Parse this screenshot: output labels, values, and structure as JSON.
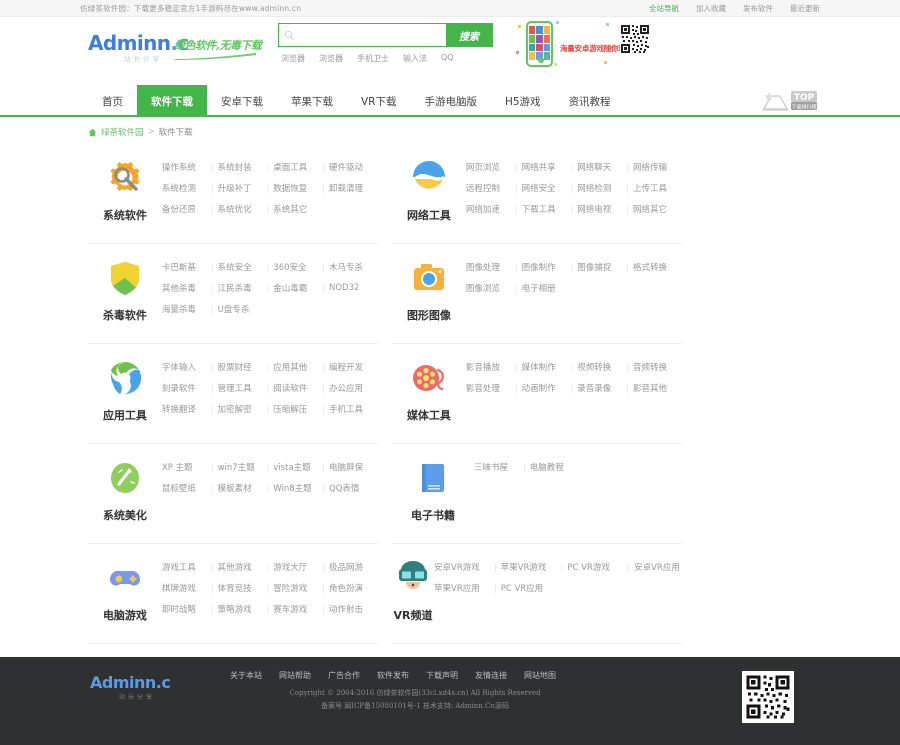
{
  "topbar": {
    "notice": "仿绿茶软件园：下载更多稳定官方1手游码尽在www.adminn.cn",
    "links": [
      {
        "label": "全站导航",
        "highlight": true
      },
      {
        "label": "加入收藏",
        "highlight": false
      },
      {
        "label": "发布软件",
        "highlight": false
      },
      {
        "label": "最近更新",
        "highlight": false
      }
    ]
  },
  "header": {
    "logo_text": "Adminn",
    "logo_suffix": ".c",
    "logo_sub": "站长分享",
    "logo_tagline": "绿色软件,无毒下载",
    "search": {
      "value": "",
      "placeholder": "",
      "button_label": "搜索",
      "icon": "search-icon"
    },
    "hot_words": [
      "浏览器",
      "浏览器",
      "手机卫士",
      "输入法",
      "QQ"
    ],
    "promo": {
      "text": "海量安卓游戏随你玩",
      "qr_label": "qr-code-icon"
    }
  },
  "nav": {
    "items": [
      {
        "label": "首页",
        "active": false
      },
      {
        "label": "软件下载",
        "active": true
      },
      {
        "label": "安卓下载",
        "active": false
      },
      {
        "label": "苹果下载",
        "active": false
      },
      {
        "label": "VR下载",
        "active": false
      },
      {
        "label": "手游电脑版",
        "active": false
      },
      {
        "label": "H5游戏",
        "active": false
      },
      {
        "label": "资讯教程",
        "active": false
      }
    ],
    "badge": {
      "label": "TOP",
      "sub": "下载排行榜"
    }
  },
  "breadcrumb": {
    "home_icon": "home-icon",
    "root": "绿茶软件园",
    "separator": ">",
    "current": "软件下载"
  },
  "categories": [
    {
      "name": "系统软件",
      "icon": "gear-wrench-icon",
      "color": "#f5a623",
      "rows": [
        [
          "操作系统",
          "系统封装",
          "桌面工具",
          "硬件驱动"
        ],
        [
          "系统检测",
          "升级补丁",
          "数据恢复",
          "卸载清理"
        ],
        [
          "备份还原",
          "系统优化",
          "系统其它"
        ]
      ]
    },
    {
      "name": "网络工具",
      "icon": "globe-icon",
      "color": "#4aa3e8",
      "rows": [
        [
          "网页浏览",
          "网络共享",
          "网络聊天",
          "网络传输"
        ],
        [
          "远程控制",
          "网络安全",
          "网络检测",
          "上传工具"
        ],
        [
          "网络加速",
          "下载工具",
          "网络电视",
          "网络其它"
        ]
      ]
    },
    {
      "name": "杀毒软件",
      "icon": "shield-icon",
      "color": "#6cc24a",
      "rows": [
        [
          "卡巴斯基",
          "系统安全",
          "360安全",
          "木马专杀"
        ],
        [
          "其他杀毒",
          "江民杀毒",
          "金山毒霸",
          "NOD32"
        ],
        [
          "海量杀毒",
          "U盘专杀"
        ]
      ]
    },
    {
      "name": "图形图像",
      "icon": "camera-icon",
      "color": "#f7b13a",
      "rows": [
        [
          "图像处理",
          "图像制作",
          "图像捕捉",
          "格式转换"
        ],
        [
          "图像浏览",
          "电子相册"
        ]
      ]
    },
    {
      "name": "应用工具",
      "icon": "recycle-icon",
      "color": "#4aa3e8",
      "rows": [
        [
          "字体输入",
          "股票财经",
          "应用其他",
          "编程开发"
        ],
        [
          "刻录软件",
          "管理工具",
          "阅读软件",
          "办公应用"
        ],
        [
          "转换翻译",
          "加密解密",
          "压缩解压",
          "手机工具"
        ]
      ]
    },
    {
      "name": "媒体工具",
      "icon": "film-reel-icon",
      "color": "#f2675f",
      "rows": [
        [
          "影音播放",
          "媒体制作",
          "视频转换",
          "音频转换"
        ],
        [
          "影音处理",
          "动画制作",
          "录音录像",
          "影音其他"
        ]
      ]
    },
    {
      "name": "系统美化",
      "icon": "brush-icon",
      "color": "#8ccf5a",
      "rows": [
        [
          "XP 主题",
          "win7主题",
          "vista主题",
          "电脑屏保"
        ],
        [
          "鼠标壁纸",
          "模板素材",
          "Win8主题",
          "QQ表情"
        ]
      ]
    },
    {
      "name": "电子书籍",
      "icon": "book-icon",
      "color": "#5a9ee8",
      "rows": [
        [
          "三味书屋",
          "电脑教程"
        ]
      ]
    },
    {
      "name": "电脑游戏",
      "icon": "gamepad-icon",
      "color": "#7b97e8",
      "rows": [
        [
          "游戏工具",
          "其他游戏",
          "游戏大厅",
          "极品网游"
        ],
        [
          "棋牌游戏",
          "体育竞技",
          "冒险游戏",
          "角色扮演"
        ],
        [
          "即时战略",
          "策略游戏",
          "赛车游戏",
          "动作射击"
        ]
      ]
    },
    {
      "name": "VR频道",
      "icon": "vr-headset-icon",
      "color": "#3aa6a6",
      "wide": true,
      "rows": [
        [
          "安卓VR游戏",
          "苹果VR游戏",
          "PC VR游戏",
          "安卓VR应用"
        ],
        [
          "苹果VR应用",
          "PC VR应用"
        ]
      ]
    }
  ],
  "footer": {
    "logo_text": "Adminn",
    "logo_suffix": ".c",
    "logo_sub": "站长分享",
    "links": [
      "关于本站",
      "网站帮助",
      "广告合作",
      "软件发布",
      "下载声明",
      "友情连接",
      "网站地图"
    ],
    "copyright_line1": "Copyright © 2004-2016 仿绿茶软件园(33cl.xd4s.cn) All Rights Reserved",
    "copyright_line2": "备案号 闽ICP备15080101号-1 技术支持: Adminn.Cn源码",
    "qr_label": "qr-code-icon"
  }
}
